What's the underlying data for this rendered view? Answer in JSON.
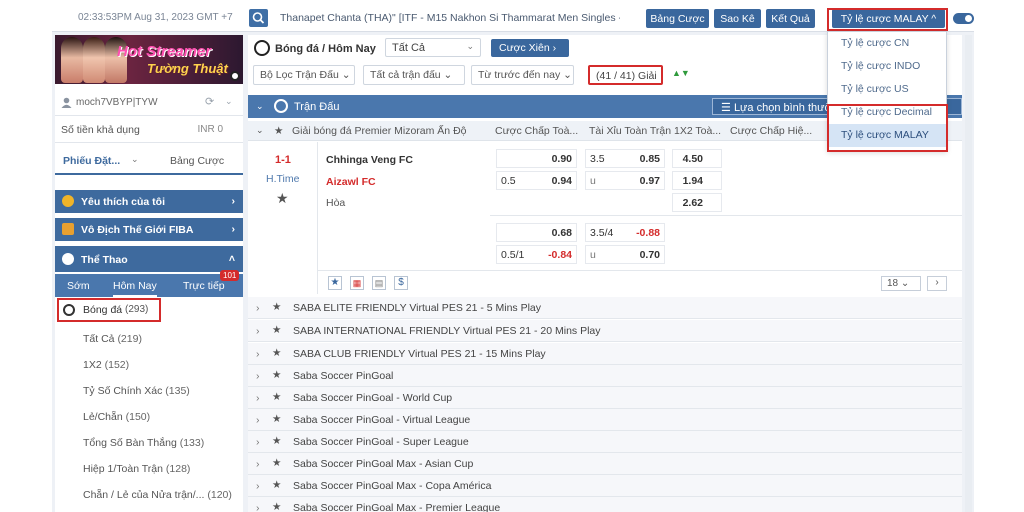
{
  "topbar": {
    "clock": "02:33:53PM Aug 31, 2023 GMT +7",
    "ticker": "Thanapet Chanta (THA)\" [ITF - M15 Nakhon Si Thammarat Men Singles -",
    "btn_betlist": "Bảng Cược",
    "btn_statement": "Sao Kê",
    "btn_result": "Kết Quả",
    "odds_select": "Tỷ lệ cược MALAY ^"
  },
  "odds_dropdown": {
    "options": [
      "Tỷ lệ cược CN",
      "Tỷ lệ cược INDO",
      "Tỷ lệ cược US",
      "Tỷ lệ cược Decimal",
      "Tỷ lệ cược MALAY"
    ],
    "selected": "Tỷ lệ cược MALAY"
  },
  "sidebar": {
    "banner_title": "Hot Streamer",
    "banner_sub": "Tường Thuật",
    "username": "moch7VBYP|TYW",
    "balance_label": "Số tiền khả dụng",
    "balance_value": "INR 0",
    "tab_slip": "Phiếu Đặt...",
    "tab_betlist": "Bảng Cược",
    "fav": "Yêu thích của tôi",
    "fiba": "Vô Địch Thế Giới FIBA",
    "sports": "Thể Thao",
    "sub_early": "Sớm",
    "sub_today": "Hôm Nay",
    "sub_live": "Trực tiếp",
    "live_count": "101",
    "football": "Bóng đá",
    "football_count": "(293)",
    "items": [
      {
        "label": "Tất Cả",
        "count": "(219)"
      },
      {
        "label": "1X2",
        "count": "(152)"
      },
      {
        "label": "Tỷ Số Chính Xác",
        "count": "(135)"
      },
      {
        "label": "Lẻ/Chẵn",
        "count": "(150)"
      },
      {
        "label": "Tổng Số Bàn Thắng",
        "count": "(133)"
      },
      {
        "label": "Hiệp 1/Toàn Trận",
        "count": "(128)"
      },
      {
        "label": "Chẵn / Lẻ của Nửa trận/...",
        "count": "(120)"
      }
    ]
  },
  "main": {
    "title": "Bóng đá / Hôm Nay",
    "select_all": "Tất Cả",
    "parlay": "Cược Xiên",
    "filter_league": "Bộ Lọc Trận Đấu",
    "filter_all": "Tất cả trận đấu",
    "filter_time": "Từ trước đến nay",
    "league_count": "(41 / 41) Giải",
    "matches_label": "Trận Đấu",
    "choose_label": "Lựa chọn bình thườ",
    "headers": {
      "league": "Giải bóng đá Premier Mizoram Ấn Độ",
      "hdp": "Cược Chấp Toà...",
      "ou": "Tài Xỉu Toàn Trận",
      "x12": "1X2 Toà...",
      "hdp_h": "Cược Chấp Hiệ..."
    },
    "match": {
      "score": "1-1",
      "status": "H.Time",
      "home": "Chhinga Veng FC",
      "away": "Aizawl FC",
      "draw": "Hòa",
      "hdp_line": "0.5",
      "hdp_home": "0.90",
      "hdp_away": "0.94",
      "ou_line": "3.5",
      "ou_u": "u",
      "ou_over": "0.85",
      "ou_under": "0.97",
      "x12_1": "4.50",
      "x12_2": "1.94",
      "x12_x": "2.62",
      "hdp2_line": "0.5/1",
      "hdp2_home": "0.68",
      "hdp2_away": "-0.84",
      "ou2_line": "3.5/4",
      "ou2_u": "u",
      "ou2_over": "-0.88",
      "ou2_under": "0.70",
      "dollar": "$",
      "page_size": "18"
    },
    "leagues": [
      "SABA ELITE FRIENDLY Virtual PES 21 - 5 Mins Play",
      "SABA INTERNATIONAL FRIENDLY Virtual PES 21 - 20 Mins Play",
      "SABA CLUB FRIENDLY Virtual PES 21 - 15 Mins Play",
      "Saba Soccer PinGoal",
      "Saba Soccer PinGoal - World Cup",
      "Saba Soccer PinGoal - Virtual League",
      "Saba Soccer PinGoal - Super League",
      "Saba Soccer PinGoal Max - Asian Cup",
      "Saba Soccer PinGoal Max - Copa América",
      "Saba Soccer PinGoal Max - Premier League"
    ]
  },
  "colors": {
    "accent": "#3a679d",
    "highlight": "#d42b2b",
    "section": "#3e6a9e"
  }
}
